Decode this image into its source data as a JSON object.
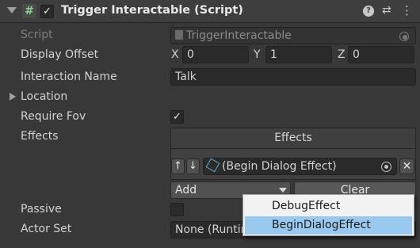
{
  "header": {
    "script_icon": "#",
    "enabled_check": "✓",
    "title": "Trigger Interactable (Script)",
    "help_icon": "?",
    "presets_icon": "⇄",
    "menu_icon": "⋮"
  },
  "fields": {
    "script_label": "Script",
    "script_value": "TriggerInteractable",
    "display_offset_label": "Display Offset",
    "offset": {
      "x_label": "X",
      "x": "0",
      "y_label": "Y",
      "y": "1",
      "z_label": "Z",
      "z": "0"
    },
    "interaction_name_label": "Interaction Name",
    "interaction_name": "Talk",
    "location_label": "Location",
    "require_fov_label": "Require Fov",
    "require_fov_check": "✓",
    "effects_label": "Effects",
    "passive_label": "Passive",
    "actor_set_label": "Actor Set",
    "actor_set_value": "None (Runtim"
  },
  "effects_list": {
    "header": "Effects",
    "up_arrow": "↑",
    "down_arrow": "↓",
    "item": "(Begin Dialog Effect)",
    "remove": "✕",
    "add_label": "Add",
    "clear_label": "Clear"
  },
  "popup": {
    "items": [
      "DebugEffect",
      "BeginDialogEffect"
    ],
    "selected": "BeginDialogEffect"
  }
}
